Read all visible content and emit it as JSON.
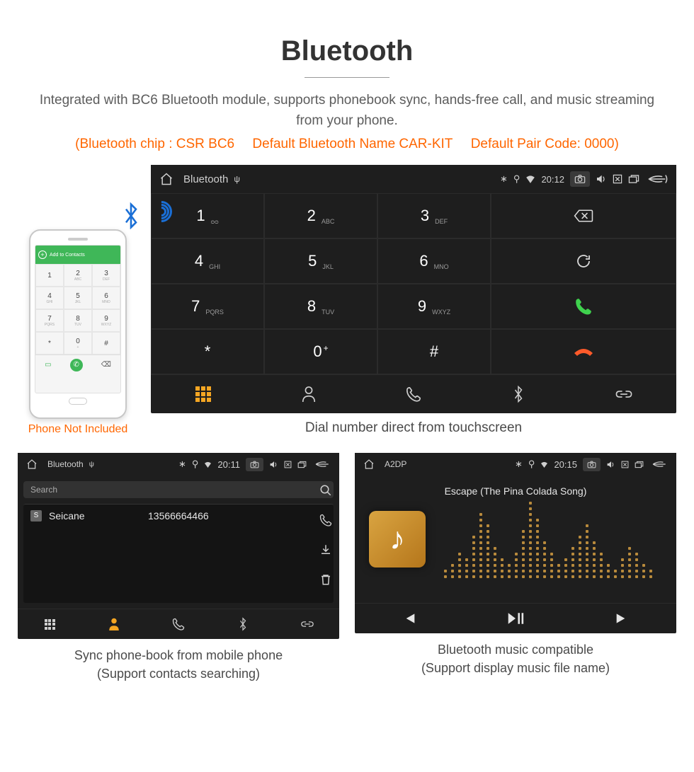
{
  "title": "Bluetooth",
  "subtitle": "Integrated with BC6 Bluetooth module, supports phonebook sync, hands-free call, and music streaming from your phone.",
  "specs": {
    "chip": "(Bluetooth chip : CSR BC6",
    "name": "Default Bluetooth Name CAR-KIT",
    "pair": "Default Pair Code: 0000)"
  },
  "phone": {
    "note": "Phone Not Included",
    "add_contacts": "Add to Contacts",
    "keys": [
      {
        "d": "1",
        "s": ""
      },
      {
        "d": "2",
        "s": "ABC"
      },
      {
        "d": "3",
        "s": "DEF"
      },
      {
        "d": "4",
        "s": "GHI"
      },
      {
        "d": "5",
        "s": "JKL"
      },
      {
        "d": "6",
        "s": "MNO"
      },
      {
        "d": "7",
        "s": "PQRS"
      },
      {
        "d": "8",
        "s": "TUV"
      },
      {
        "d": "9",
        "s": "WXYZ"
      },
      {
        "d": "*",
        "s": ""
      },
      {
        "d": "0",
        "s": "+"
      },
      {
        "d": "#",
        "s": ""
      }
    ]
  },
  "dialer": {
    "topbar": {
      "title": "Bluetooth",
      "time": "20:12"
    },
    "keys": [
      {
        "d": "1",
        "s": "∞"
      },
      {
        "d": "2",
        "s": "ABC"
      },
      {
        "d": "3",
        "s": "DEF"
      },
      {
        "d": "4",
        "s": "GHI"
      },
      {
        "d": "5",
        "s": "JKL"
      },
      {
        "d": "6",
        "s": "MNO"
      },
      {
        "d": "7",
        "s": "PQRS"
      },
      {
        "d": "8",
        "s": "TUV"
      },
      {
        "d": "9",
        "s": "WXYZ"
      },
      {
        "d": "*",
        "s": ""
      },
      {
        "d": "0",
        "s": "+",
        "sup": "+"
      },
      {
        "d": "#",
        "s": ""
      }
    ],
    "caption": "Dial number direct from touchscreen"
  },
  "contacts": {
    "topbar": {
      "title": "Bluetooth",
      "time": "20:11"
    },
    "search": "Search",
    "list": [
      {
        "letter": "S",
        "name": "Seicane",
        "num": "13566664466"
      }
    ],
    "caption": "Sync phone-book from mobile phone",
    "caption2": "(Support contacts searching)"
  },
  "music": {
    "topbar": {
      "title": "A2DP",
      "time": "20:15"
    },
    "song": "Escape (The Pina Colada Song)",
    "caption": "Bluetooth music compatible",
    "caption2": "(Support display music file name)"
  }
}
